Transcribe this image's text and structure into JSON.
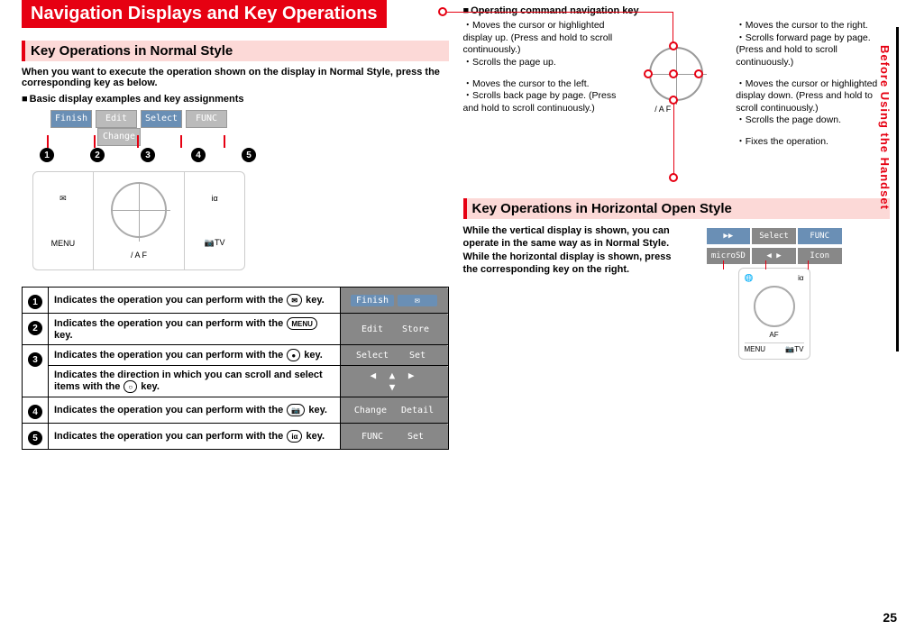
{
  "sideTab": "Before Using the Handset",
  "pageNumber": "25",
  "titleBar": "Navigation Displays and Key Operations",
  "section1": {
    "heading": "Key Operations in Normal Style",
    "intro": "When you want to execute the operation shown on the display in Normal Style, press the corresponding key as below.",
    "subLabel": "Basic display examples and key assignments",
    "screenLabels": {
      "a": "Finish",
      "b": "Edit",
      "c": "Select",
      "d": "FUNC",
      "e": "Change"
    },
    "keypad": {
      "mail": "✉",
      "menu": "MENU",
      "af": "/ A F",
      "tv": "TV",
      "cam": "📷",
      "ia": "iα"
    }
  },
  "table": {
    "rows": [
      {
        "num": "1",
        "text": "Indicates the operation you can perform with the",
        "keyLabel": "✉",
        "keySuffix": " key.",
        "chips": [
          "Finish",
          "✉"
        ],
        "chipStyle": "blue"
      },
      {
        "num": "2",
        "text": "Indicates the operation you can perform with the",
        "keyLabel": "MENU",
        "keySuffix": " key.",
        "chips": [
          "Edit",
          "Store"
        ],
        "chipStyle": ""
      },
      {
        "num": "3",
        "text": "Indicates the operation you can perform with the",
        "keyLabel": "●",
        "keySuffix": " key.",
        "chips": [
          "Select",
          "Set"
        ],
        "chipStyle": ""
      },
      {
        "num": "3b",
        "text": "Indicates the direction in which you can scroll and select items with the",
        "keyLabel": "○",
        "keySuffix": " key.",
        "chips": [
          "◀ ▲ ▶",
          "▼"
        ],
        "chipStyle": "arrows"
      },
      {
        "num": "4",
        "text": "Indicates the operation you can perform with the",
        "keyLabel": "📷",
        "keySuffix": " key.",
        "chips": [
          "Change",
          "Detail"
        ],
        "chipStyle": ""
      },
      {
        "num": "5",
        "text": "Indicates the operation you can perform with the",
        "keyLabel": "iα",
        "keySuffix": " key.",
        "chips": [
          "FUNC",
          "Set"
        ],
        "chipStyle": ""
      }
    ]
  },
  "nav": {
    "label": "Operating command navigation key",
    "up": [
      "Moves the cursor or highlighted display up. (Press and hold to scroll continuously.)",
      "Scrolls the page up."
    ],
    "left": [
      "Moves the cursor to the left.",
      "Scrolls back page by page. (Press and hold to scroll continuously.)"
    ],
    "right": [
      "Moves the cursor to the right.",
      "Scrolls forward page by page. (Press and hold to scroll continuously.)"
    ],
    "down": [
      "Moves the cursor or highlighted display down. (Press and hold to scroll continuously.)",
      "Scrolls the page down."
    ],
    "center": [
      "Fixes the operation."
    ],
    "af": "/ A F"
  },
  "section2": {
    "heading": "Key Operations in Horizontal Open Style",
    "text": "While the vertical display is shown, you can operate in the same way as in Normal Style.\nWhile the horizontal display is shown, press the corresponding key on the right.",
    "screen": {
      "a": "▶▶",
      "b": "Select",
      "c": "FUNC",
      "d": "microSD",
      "e": "◀ ▶",
      "f": "Icon"
    },
    "keypad": {
      "globe": "🌐",
      "ia": "iα",
      "af": "AF",
      "menu": "MENU",
      "tv": "TV",
      "cam": "📷"
    }
  }
}
